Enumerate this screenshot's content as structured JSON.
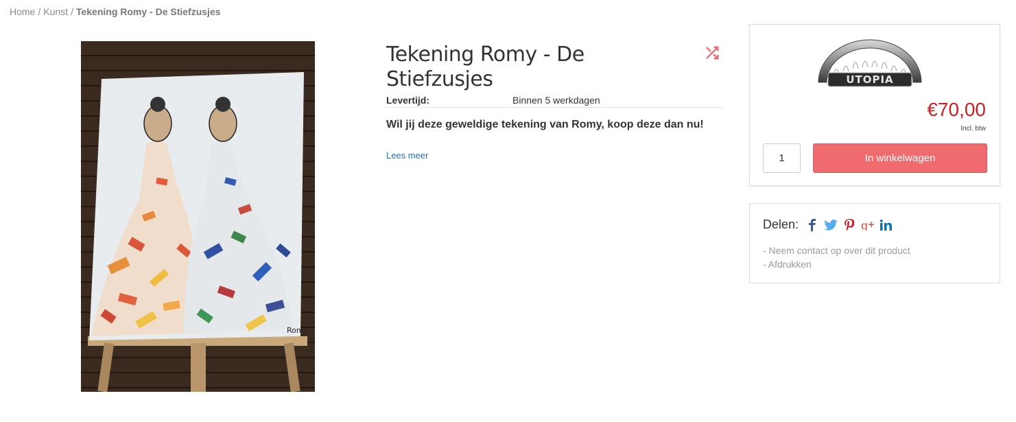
{
  "breadcrumb": {
    "items": [
      "Home",
      "Kunst"
    ],
    "separator": "/",
    "current": "Tekening Romy - De Stiefzusjes"
  },
  "product": {
    "title": "Tekening Romy - De Stiefzusjes",
    "delivery_label": "Levertijd:",
    "delivery_value": "Binnen 5 werkdagen",
    "lead": "Wil jij deze geweldige tekening van Romy, koop deze dan nu!",
    "read_more": "Lees meer",
    "image_signature": "Romy"
  },
  "buy": {
    "brand": "UTOPIA",
    "price": "€70,00",
    "vat_note": "Incl. btw",
    "quantity": "1",
    "add_to_cart": "In winkelwagen"
  },
  "share": {
    "label": "Delen:",
    "networks": [
      "facebook-icon",
      "twitter-icon",
      "pinterest-icon",
      "google-plus-icon",
      "linkedin-icon"
    ],
    "links": [
      "- Neem contact op over dit product",
      "- Afdrukken"
    ]
  },
  "colors": {
    "accent": "#ef6b6e",
    "price": "#cc1f1f",
    "link": "#2a6eb8",
    "facebook": "#3b5998",
    "twitter": "#55acee",
    "pinterest": "#cb2027",
    "google_plus": "#dd4b39",
    "linkedin": "#0077b5"
  }
}
